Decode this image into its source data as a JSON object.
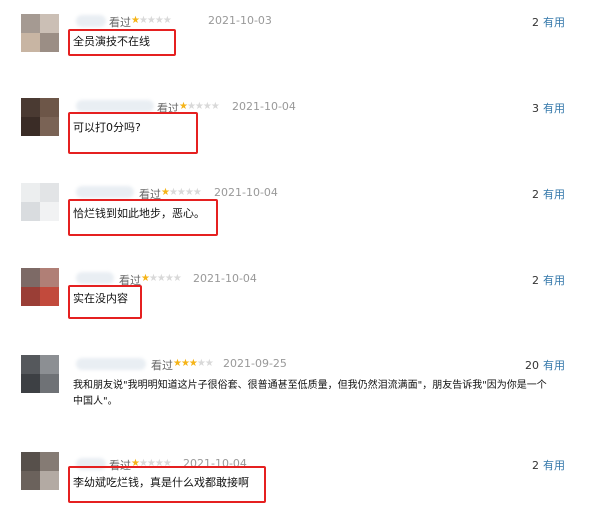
{
  "reviews": [
    {
      "watched_label": "看过",
      "rating": 1,
      "date": "2021-10-03",
      "useful_count": "2",
      "useful_label": "有用",
      "content": "全员演技不在线",
      "avatar_colors": [
        "#a59a92",
        "#cbbfb5",
        "#c8b5a3",
        "#9b8e85"
      ]
    },
    {
      "watched_label": "看过",
      "rating": 1,
      "date": "2021-10-04",
      "useful_count": "3",
      "useful_label": "有用",
      "content": "可以打0分吗?",
      "avatar_colors": [
        "#4a3a32",
        "#6d5648",
        "#3a2c26",
        "#7a6355"
      ]
    },
    {
      "watched_label": "看过",
      "rating": 1,
      "date": "2021-10-04",
      "useful_count": "2",
      "useful_label": "有用",
      "content": "恰烂钱到如此地步，恶心。",
      "avatar_colors": [
        "#eceeef",
        "#e2e4e6",
        "#d9dcdf",
        "#f1f2f3"
      ]
    },
    {
      "watched_label": "看过",
      "rating": 1,
      "date": "2021-10-04",
      "useful_count": "2",
      "useful_label": "有用",
      "content": "实在没内容",
      "avatar_colors": [
        "#7d6a66",
        "#b07f76",
        "#9a3e36",
        "#c24a3c"
      ]
    },
    {
      "watched_label": "看过",
      "rating": 3,
      "date": "2021-09-25",
      "useful_count": "20",
      "useful_label": "有用",
      "content_line1": "我和朋友说\"我明明知道这片子很俗套、很普通甚至低质量，但我仍然泪流满面\"，朋友告诉我\"因为你是一个",
      "content_line2": "中国人\"。",
      "avatar_colors": [
        "#55585c",
        "#8c8f93",
        "#3d4044",
        "#6f7276"
      ]
    },
    {
      "watched_label": "看过",
      "rating": 1,
      "date": "2021-10-04",
      "useful_count": "2",
      "useful_label": "有用",
      "content": "李幼斌吃烂钱，真是什么戏都敢接啊",
      "avatar_colors": [
        "#57504b",
        "#857b74",
        "#6b625c",
        "#b3aaa3"
      ]
    }
  ]
}
